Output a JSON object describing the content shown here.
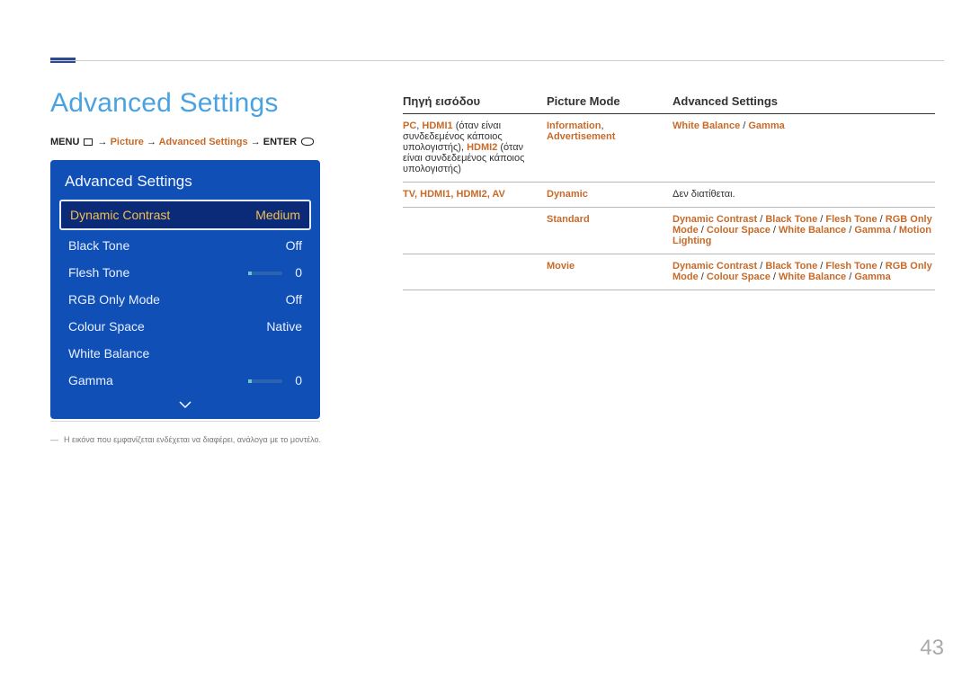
{
  "page": {
    "title": "Advanced Settings",
    "page_number": "43",
    "footnote": "Η εικόνα που εμφανίζεται ενδέχεται να διαφέρει, ανάλογα με το μοντέλο."
  },
  "breadcrumb": {
    "menu": "MENU",
    "arrow": "→",
    "p1": "Picture",
    "p2": "Advanced Settings",
    "enter": "ENTER"
  },
  "osd": {
    "title": "Advanced Settings",
    "rows": [
      {
        "label": "Dynamic Contrast",
        "value": "Medium",
        "selected": true
      },
      {
        "label": "Black Tone",
        "value": "Off"
      },
      {
        "label": "Flesh Tone",
        "value": "0",
        "slider": true
      },
      {
        "label": "RGB Only Mode",
        "value": "Off"
      },
      {
        "label": "Colour Space",
        "value": "Native"
      },
      {
        "label": "White Balance",
        "value": ""
      },
      {
        "label": "Gamma",
        "value": "0",
        "slider": true
      }
    ]
  },
  "table": {
    "headers": {
      "h1": "Πηγή εισόδου",
      "h2": "Picture Mode",
      "h3": "Advanced Settings"
    },
    "rows": [
      {
        "c1_pre": "PC",
        "c1_sep1": ", ",
        "c1_b": "HDMI1",
        "c1_txt1": " (όταν είναι συνδεδεμένος κάποιος υπολογιστής), ",
        "c1_c": "HDMI2",
        "c1_txt2": " (όταν είναι συνδεδεμένος κάποιος υπολογιστής)",
        "c2_a": "Information",
        "c2_sep": ",",
        "c2_b": "Advertisement",
        "c3_a": "White Balance",
        "c3_sep": " / ",
        "c3_b": "Gamma"
      },
      {
        "c1": "TV, HDMI1, HDMI2, AV",
        "c2": "Dynamic",
        "c3": "Δεν διατίθεται."
      },
      {
        "c1": "",
        "c2": "Standard",
        "c3_parts": [
          "Dynamic Contrast",
          " / ",
          "Black Tone",
          " / ",
          "Flesh Tone",
          " / ",
          "RGB Only Mode",
          " / ",
          "Colour Space",
          " / ",
          "White Balance",
          " / ",
          "Gamma",
          " / ",
          "Motion Lighting"
        ]
      },
      {
        "c1": "",
        "c2": "Movie",
        "c3_parts": [
          "Dynamic Contrast",
          " / ",
          "Black Tone",
          " / ",
          "Flesh Tone",
          " / ",
          "RGB Only Mode",
          " / ",
          "Colour Space",
          " / ",
          "White Balance",
          " / ",
          "Gamma"
        ]
      }
    ]
  }
}
